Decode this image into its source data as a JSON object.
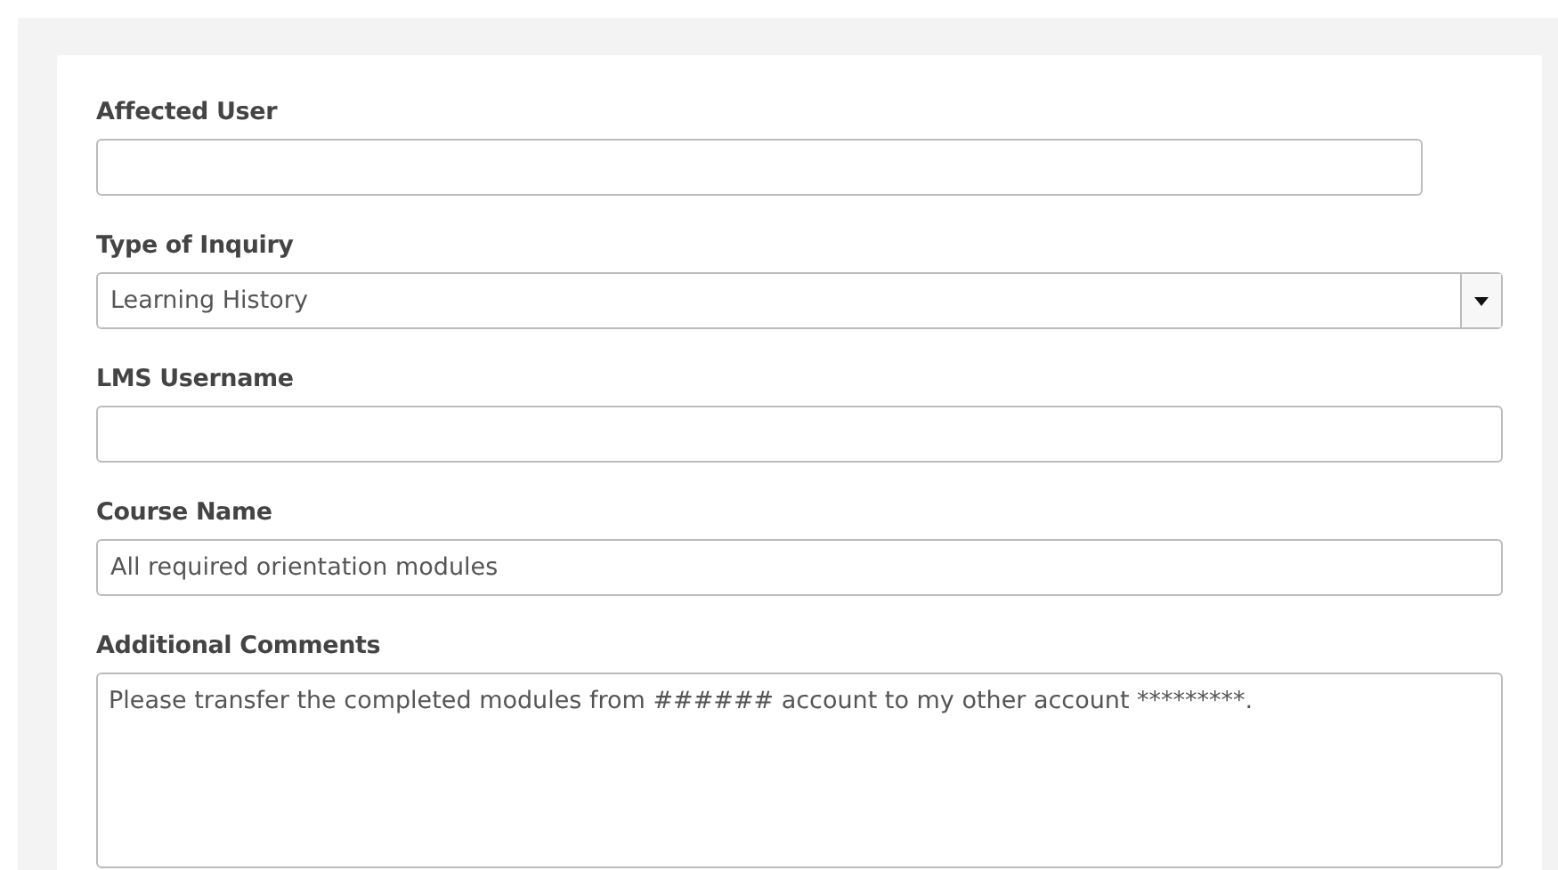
{
  "fields": [
    {
      "kind": "text",
      "label": "Affected User"
    },
    {
      "kind": "select",
      "label": "Type of Inquiry",
      "value": "Learning History"
    },
    {
      "kind": "text",
      "label": "LMS Username"
    },
    {
      "kind": "text",
      "label": "Course Name",
      "value": "All required orientation modules"
    },
    {
      "kind": "textarea",
      "label": "Additional Comments",
      "value": "Please transfer the completed modules from ###### account to my other account *********."
    }
  ]
}
